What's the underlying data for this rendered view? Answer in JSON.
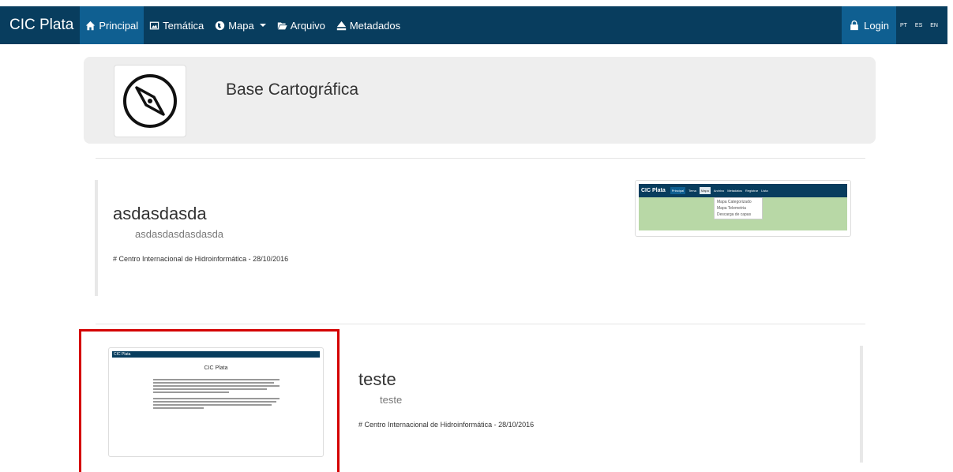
{
  "navbar": {
    "brand": "CIC Plata",
    "items": [
      {
        "label": "Principal",
        "icon": "home-icon"
      },
      {
        "label": "Temática",
        "icon": "picture-icon"
      },
      {
        "label": "Mapa",
        "icon": "globe-icon"
      },
      {
        "label": "Arquivo",
        "icon": "folder-open-icon"
      },
      {
        "label": "Metadados",
        "icon": "eject-icon"
      }
    ],
    "login": "Login",
    "languages": [
      "PT",
      "ES",
      "EN"
    ]
  },
  "jumbotron": {
    "title": "Base Cartográfica",
    "icon": "compass-icon"
  },
  "posts": [
    {
      "title": "asdasdasda",
      "subtitle": "asdasdasdasdasda",
      "meta": "# Centro Internacional de Hidroinformática - 28/10/2016",
      "thumbnail": {
        "brand": "CIC Plata",
        "nav": [
          "Principal",
          "Tema",
          "Mapa",
          "Archivo",
          "Metadatos",
          "Registrar",
          "Lista"
        ],
        "dropdown": [
          "Mapa Categorizado",
          "Mapa Telemetria",
          "Descarga de capas"
        ]
      }
    },
    {
      "title": "teste",
      "subtitle": "teste",
      "meta": "# Centro Internacional de Hidroinformática - 28/10/2016",
      "thumbnail": {
        "brand": "CIC Plata",
        "heading": "CIC Plata"
      }
    }
  ],
  "colors": {
    "navbar": "#083d5e",
    "navbar_active": "#0f5f91",
    "highlight": "#d40000"
  }
}
